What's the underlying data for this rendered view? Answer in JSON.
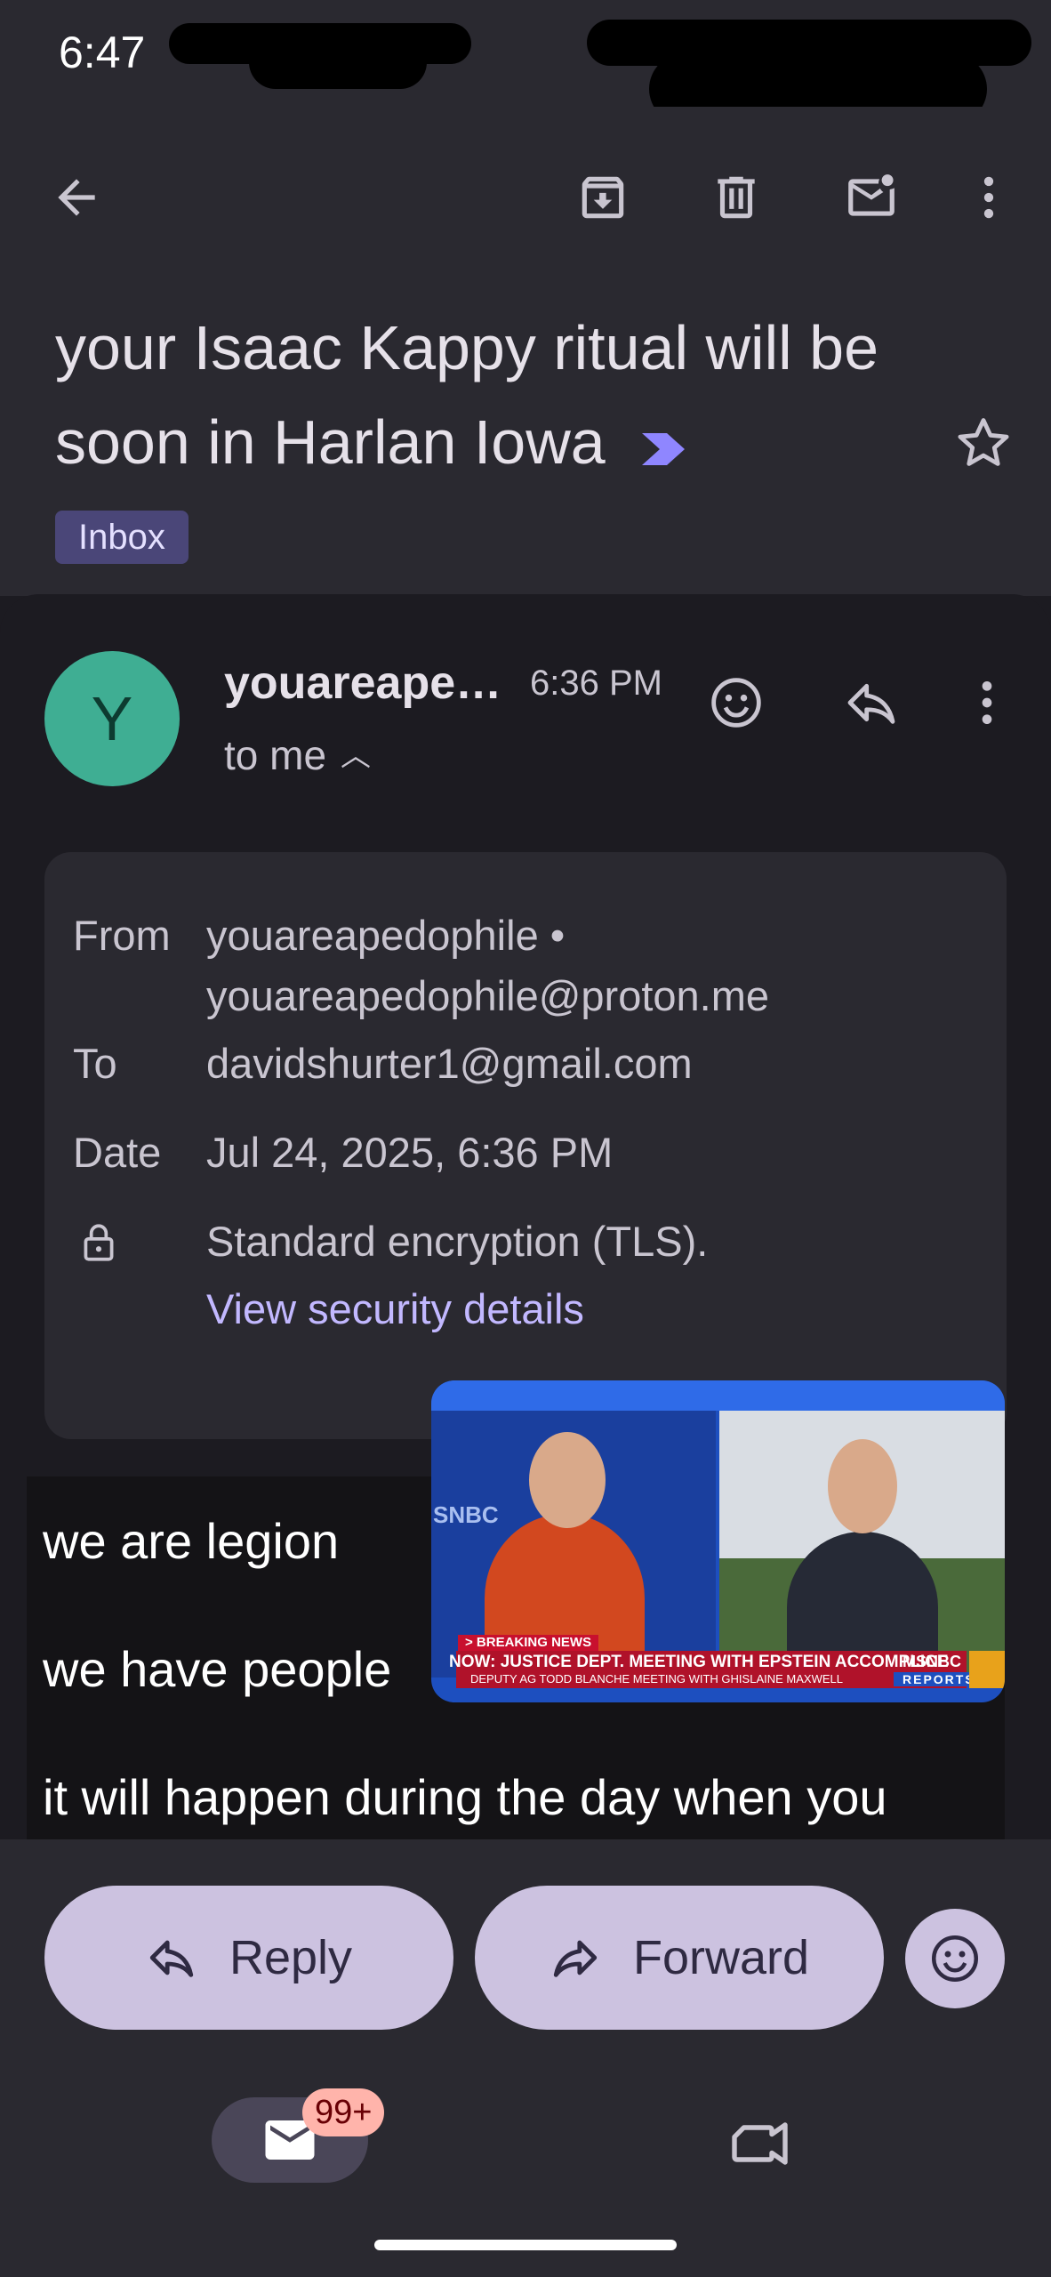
{
  "status_bar": {
    "time": "6:47"
  },
  "toolbar": {
    "icons": [
      "back-arrow-icon",
      "archive-icon",
      "delete-icon",
      "mark-unread-icon",
      "more-vert-icon"
    ]
  },
  "email": {
    "subject": "your Isaac Kappy ritual will be soon in Harlan Iowa",
    "label": "Inbox",
    "sender_initial": "Y",
    "sender_name": "youareape…",
    "time": "6:36 PM",
    "recipient_summary": "to me",
    "details": {
      "from_label": "From",
      "from_name": "youareapedophile •",
      "from_email": "youareapedophile@proton.me",
      "to_label": "To",
      "to_value": "davidshurter1@gmail.com",
      "date_label": "Date",
      "date_value": "Jul 24, 2025, 6:36 PM",
      "encryption": "Standard encryption (TLS).",
      "security_link": "View security details"
    },
    "body_lines": [
      "we are legion",
      "we have people",
      "it will happen during the day when you"
    ]
  },
  "video_overlay": {
    "network": "SNBC",
    "breaking": "> BREAKING NEWS",
    "headline": "NOW: JUSTICE DEPT. MEETING WITH EPSTEIN ACCOMPLICE",
    "subheadline": "DEPUTY AG TODD BLANCHE MEETING WITH GHISLAINE MAXWELL",
    "brand": "MSNBC",
    "brand_sub": "REPORTS"
  },
  "actions": {
    "reply": "Reply",
    "forward": "Forward"
  },
  "bottom_nav": {
    "mail_badge": "99+"
  },
  "colors": {
    "avatar": "#3fae93",
    "accent": "#c2b8ff",
    "button": "#ccc2e0",
    "badge": "#ffb4ab"
  }
}
